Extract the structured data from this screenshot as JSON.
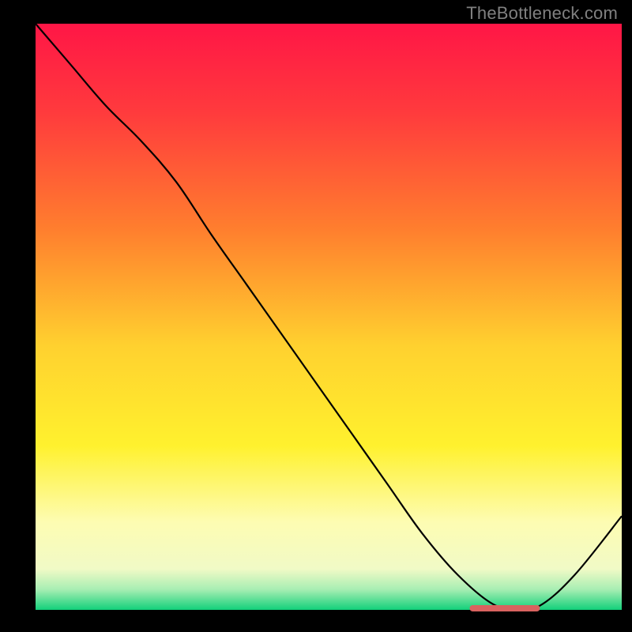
{
  "watermark": "TheBottleneck.com",
  "chart_data": {
    "type": "line",
    "title": "",
    "xlabel": "",
    "ylabel": "",
    "xlim": [
      0,
      100
    ],
    "ylim": [
      0,
      100
    ],
    "grid": false,
    "legend": false,
    "gradient_stops": [
      {
        "offset": 0.0,
        "color": "#ff1646"
      },
      {
        "offset": 0.15,
        "color": "#ff3a3d"
      },
      {
        "offset": 0.35,
        "color": "#ff7e2e"
      },
      {
        "offset": 0.55,
        "color": "#ffd12f"
      },
      {
        "offset": 0.72,
        "color": "#fff12e"
      },
      {
        "offset": 0.85,
        "color": "#fdfcb2"
      },
      {
        "offset": 0.93,
        "color": "#f1fac6"
      },
      {
        "offset": 0.965,
        "color": "#a8eeb3"
      },
      {
        "offset": 1.0,
        "color": "#12d07a"
      }
    ],
    "series": [
      {
        "name": "bottleneck-curve",
        "color": "#000000",
        "x": [
          0,
          6,
          12,
          18,
          24,
          30,
          36,
          42,
          48,
          54,
          60,
          66,
          72,
          78,
          82,
          86,
          92,
          100
        ],
        "y": [
          100,
          93,
          86,
          80,
          73,
          64,
          55.5,
          47,
          38.5,
          30,
          21.5,
          13,
          6,
          1,
          0.3,
          0.7,
          6,
          16
        ]
      }
    ],
    "marker": {
      "name": "optimal-range",
      "color": "#d9625f",
      "x_start": 74,
      "x_end": 86,
      "y": 0.3
    }
  }
}
